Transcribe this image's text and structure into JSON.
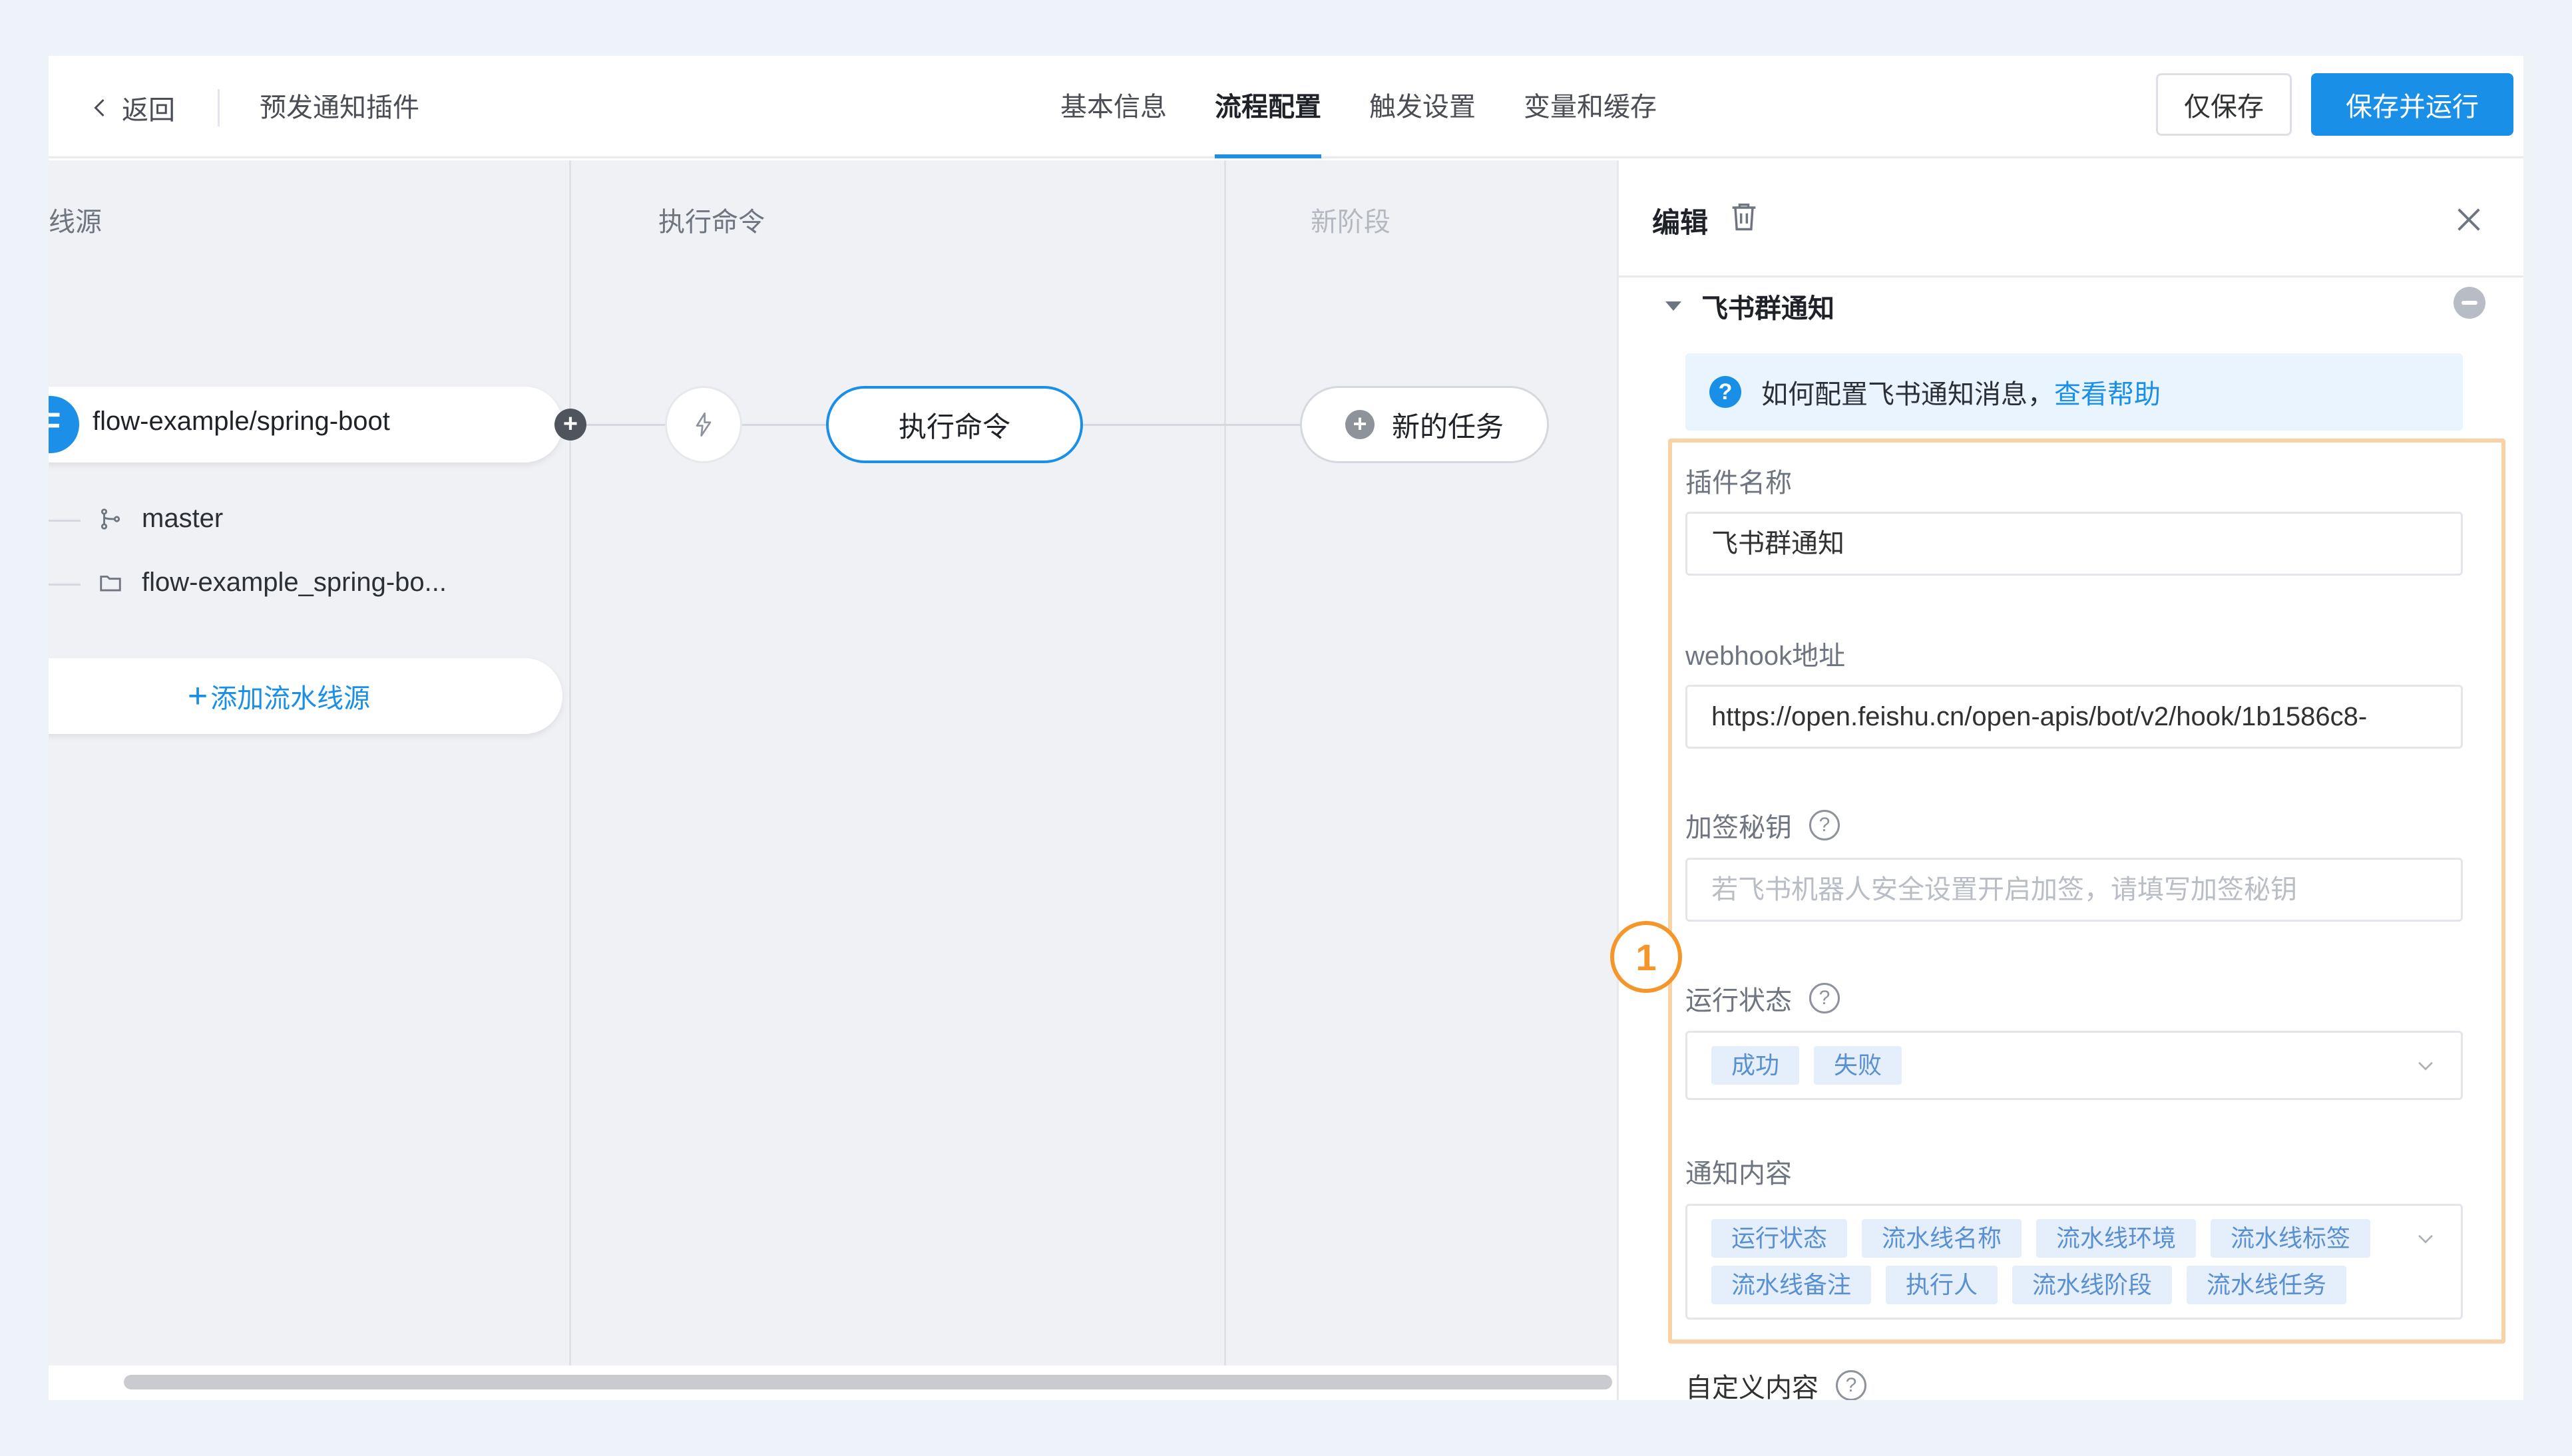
{
  "header": {
    "back_label": "返回",
    "plugin_title": "预发通知插件",
    "tabs": [
      "基本信息",
      "流程配置",
      "触发设置",
      "变量和缓存"
    ],
    "active_tab": "流程配置",
    "save_only_label": "仅保存",
    "save_run_label": "保存并运行"
  },
  "canvas": {
    "stages": [
      {
        "title": "线源"
      },
      {
        "title": "执行命令"
      },
      {
        "title": "新阶段"
      }
    ],
    "source": {
      "icon_letter": "F",
      "repo": "flow-example/spring-boot",
      "branch": "master",
      "folder": "flow-example_spring-bo..."
    },
    "add_source_label": "添加流水线源",
    "exec_task_label": "执行命令",
    "new_task_label": "新的任务"
  },
  "marker": {
    "number": "1"
  },
  "panel": {
    "title": "编辑",
    "section_title": "飞书群通知",
    "help_text": "如何配置飞书通知消息，",
    "help_link": "查看帮助",
    "fields": {
      "plugin_name_label": "插件名称",
      "plugin_name_value": "飞书群通知",
      "webhook_label": "webhook地址",
      "webhook_value": "https://open.feishu.cn/open-apis/bot/v2/hook/1b1586c8-",
      "sign_label": "加签秘钥",
      "sign_placeholder": "若飞书机器人安全设置开启加签，请填写加签秘钥",
      "run_status_label": "运行状态",
      "run_status_tags": [
        "成功",
        "失败"
      ],
      "notify_content_label": "通知内容",
      "notify_content_tags": [
        "运行状态",
        "流水线名称",
        "流水线环境",
        "流水线标签",
        "流水线备注",
        "执行人",
        "流水线阶段",
        "流水线任务"
      ],
      "custom_content_label": "自定义内容"
    }
  },
  "colors": {
    "accent": "#1a8fe8",
    "highlight_border": "#f9d2a6",
    "marker": "#f5962a"
  }
}
